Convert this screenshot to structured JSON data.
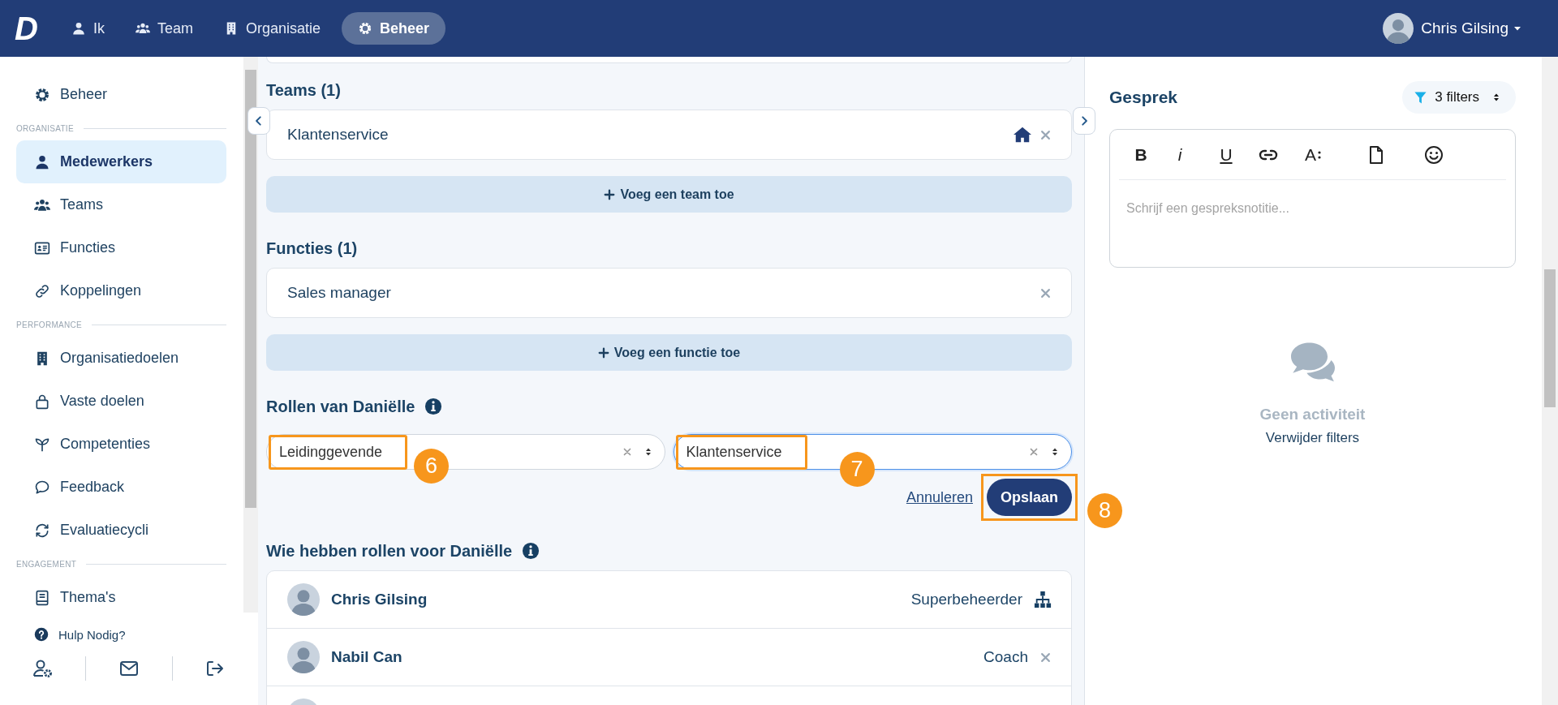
{
  "topbar": {
    "logo": "D",
    "nav": [
      {
        "label": "Ik",
        "selected": false
      },
      {
        "label": "Team",
        "selected": false
      },
      {
        "label": "Organisatie",
        "selected": false
      },
      {
        "label": "Beheer",
        "selected": true
      }
    ],
    "user": {
      "name": "Chris Gilsing"
    }
  },
  "sidebar": {
    "items": [
      {
        "kind": "item",
        "label": "Beheer",
        "selected": false
      },
      {
        "kind": "section",
        "label": "ORGANISATIE"
      },
      {
        "kind": "item",
        "label": "Medewerkers",
        "selected": true
      },
      {
        "kind": "item",
        "label": "Teams",
        "selected": false
      },
      {
        "kind": "item",
        "label": "Functies",
        "selected": false
      },
      {
        "kind": "item",
        "label": "Koppelingen",
        "selected": false
      },
      {
        "kind": "section",
        "label": "PERFORMANCE"
      },
      {
        "kind": "item",
        "label": "Organisatiedoelen",
        "selected": false
      },
      {
        "kind": "item",
        "label": "Vaste doelen",
        "selected": false
      },
      {
        "kind": "item",
        "label": "Competenties",
        "selected": false
      },
      {
        "kind": "item",
        "label": "Feedback",
        "selected": false
      },
      {
        "kind": "item",
        "label": "Evaluatiecycli",
        "selected": false
      },
      {
        "kind": "section",
        "label": "ENGAGEMENT"
      },
      {
        "kind": "item",
        "label": "Thema's",
        "selected": false
      }
    ],
    "help": "Hulp Nodig?"
  },
  "main": {
    "sections": [
      {
        "kind": "list",
        "title": "Teams (1)",
        "items": [
          {
            "label": "Klantenservice",
            "home": true
          }
        ],
        "add": "Voeg een team toe"
      },
      {
        "kind": "list",
        "title": "Functies (1)",
        "items": [
          {
            "label": "Sales manager",
            "home": false
          }
        ],
        "add": "Voeg een functie toe"
      },
      {
        "kind": "roles",
        "title": "Rollen van Daniëlle",
        "info": true,
        "selects": [
          {
            "value": "Leidinggevende",
            "focused": false,
            "annotation": "6"
          },
          {
            "value": "Klantenservice",
            "focused": true,
            "annotation": "7"
          }
        ],
        "cancel": "Annuleren",
        "save": {
          "label": "Opslaan",
          "annotation": "8"
        }
      },
      {
        "kind": "holders",
        "title": "Wie hebben rollen voor Daniëlle",
        "info": true,
        "rows": [
          {
            "kind": "hierarchy",
            "name": "Chris Gilsing",
            "role": "Superbeheerder"
          },
          {
            "kind": "removable",
            "name": "Nabil Can",
            "role": "Coach"
          },
          {
            "kind": "avatar-only"
          }
        ]
      }
    ]
  },
  "panel": {
    "title": "Gesprek",
    "filter": "3 filters",
    "editor": {
      "tools": [
        {
          "kind": "bold",
          "label": "B"
        },
        {
          "kind": "italic",
          "label": "i"
        },
        {
          "kind": "underline",
          "label": "U"
        },
        {
          "kind": "link"
        },
        {
          "kind": "font-size",
          "label": "A"
        },
        {
          "kind": "file"
        },
        {
          "kind": "emoji"
        }
      ],
      "placeholder": "Schrijf een gespreksnotitie..."
    },
    "empty": {
      "title": "Geen activiteit",
      "link": "Verwijder filters"
    }
  }
}
